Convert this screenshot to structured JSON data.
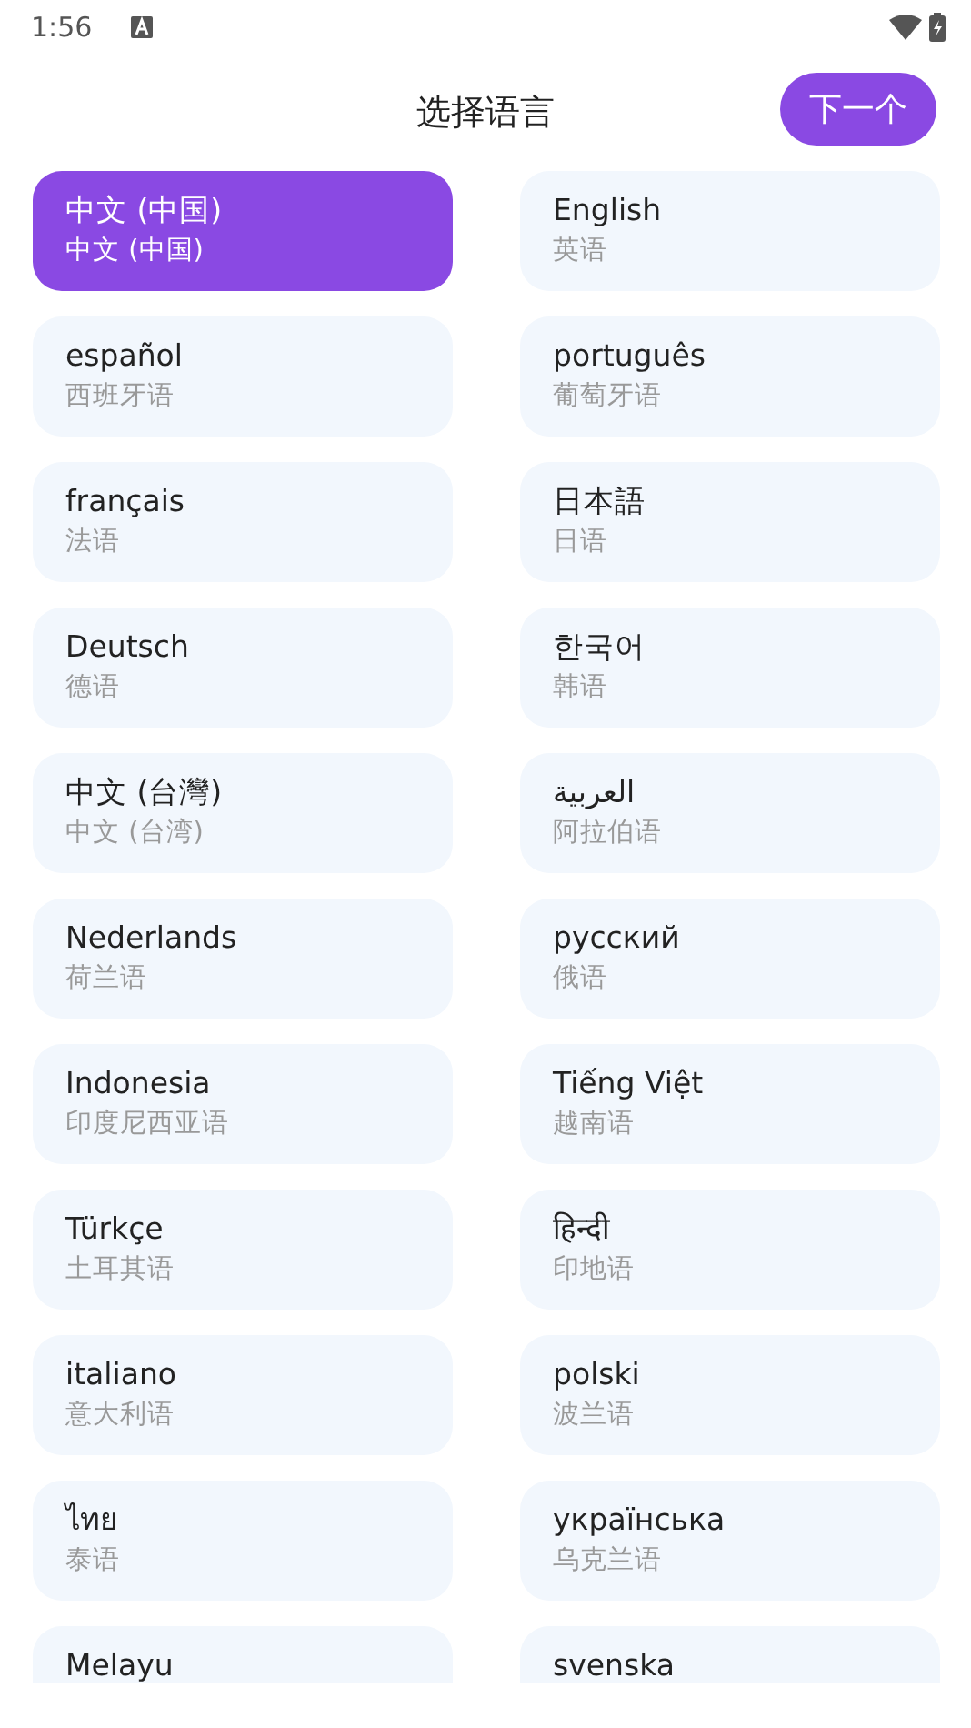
{
  "status_bar": {
    "time": "1:56"
  },
  "header": {
    "title": "选择语言",
    "next_button": "下一个"
  },
  "languages": [
    {
      "name": "中文 (中国)",
      "subtitle": "中文 (中国)",
      "selected": true
    },
    {
      "name": "English",
      "subtitle": "英语",
      "selected": false
    },
    {
      "name": "español",
      "subtitle": "西班牙语",
      "selected": false
    },
    {
      "name": "português",
      "subtitle": "葡萄牙语",
      "selected": false
    },
    {
      "name": "français",
      "subtitle": "法语",
      "selected": false
    },
    {
      "name": "日本語",
      "subtitle": "日语",
      "selected": false
    },
    {
      "name": "Deutsch",
      "subtitle": "德语",
      "selected": false
    },
    {
      "name": "한국어",
      "subtitle": "韩语",
      "selected": false
    },
    {
      "name": "中文 (台灣)",
      "subtitle": "中文 (台湾)",
      "selected": false
    },
    {
      "name": "العربية",
      "subtitle": "阿拉伯语",
      "selected": false
    },
    {
      "name": "Nederlands",
      "subtitle": "荷兰语",
      "selected": false
    },
    {
      "name": "русский",
      "subtitle": "俄语",
      "selected": false
    },
    {
      "name": "Indonesia",
      "subtitle": "印度尼西亚语",
      "selected": false
    },
    {
      "name": "Tiếng Việt",
      "subtitle": "越南语",
      "selected": false
    },
    {
      "name": "Türkçe",
      "subtitle": "土耳其语",
      "selected": false
    },
    {
      "name": "हिन्दी",
      "subtitle": "印地语",
      "selected": false
    },
    {
      "name": "italiano",
      "subtitle": "意大利语",
      "selected": false
    },
    {
      "name": "polski",
      "subtitle": "波兰语",
      "selected": false
    },
    {
      "name": "ไทย",
      "subtitle": "泰语",
      "selected": false
    },
    {
      "name": "українська",
      "subtitle": "乌克兰语",
      "selected": false
    },
    {
      "name": "Melayu",
      "selected": false
    },
    {
      "name": "svenska",
      "selected": false
    }
  ]
}
